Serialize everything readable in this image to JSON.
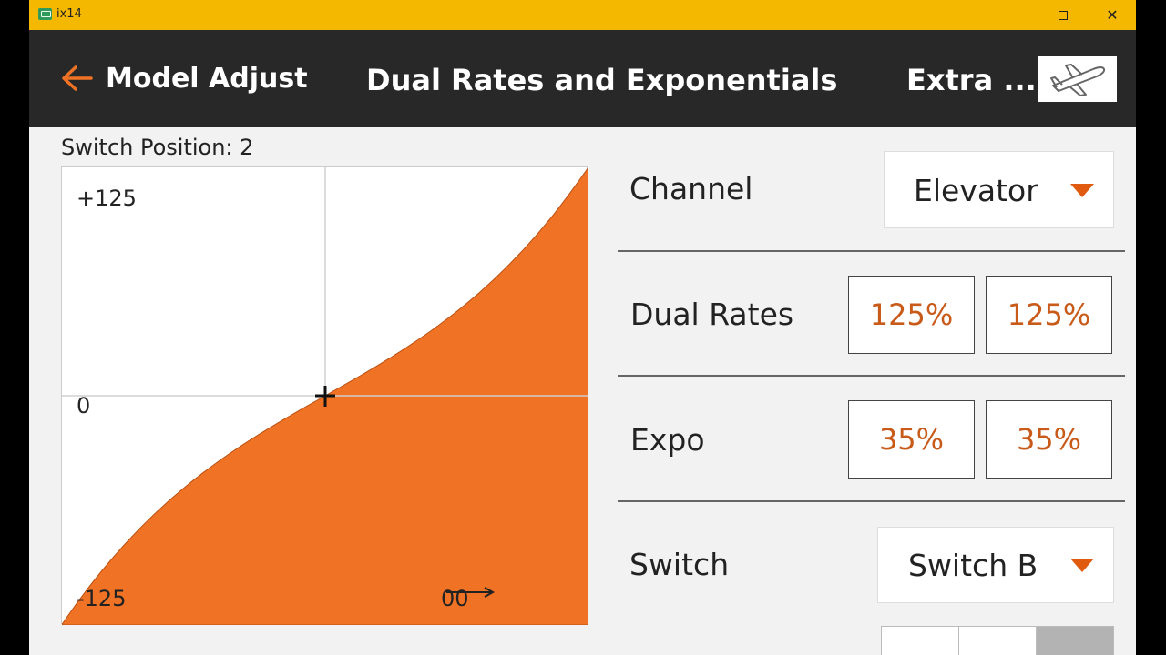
{
  "window": {
    "title": "ix14",
    "colors": {
      "titlebar": "#f5b800",
      "header": "#282828",
      "accent": "#f07325"
    }
  },
  "header": {
    "back_label": "Model Adjust",
    "title": "Dual Rates and Exponentials",
    "next_label": "Extra ...",
    "model_icon": "airplane-icon"
  },
  "graph": {
    "switch_position_label": "Switch Position: 2",
    "top_label": "+125",
    "mid_label": "0",
    "bottom_label": "-125",
    "position_from": "0",
    "position_to": "0"
  },
  "chart_data": {
    "type": "area",
    "x_range": [
      -100,
      100
    ],
    "ylim": [
      -125,
      125
    ],
    "rate_percent": 125,
    "expo_percent": 35,
    "fill_color": "#f07325"
  },
  "settings": {
    "channel": {
      "label": "Channel",
      "value": "Elevator"
    },
    "dual_rates": {
      "label": "Dual Rates",
      "values": [
        "125%",
        "125%"
      ]
    },
    "expo": {
      "label": "Expo",
      "values": [
        "35%",
        "35%"
      ]
    },
    "switch": {
      "label": "Switch",
      "value": "Switch B"
    }
  }
}
